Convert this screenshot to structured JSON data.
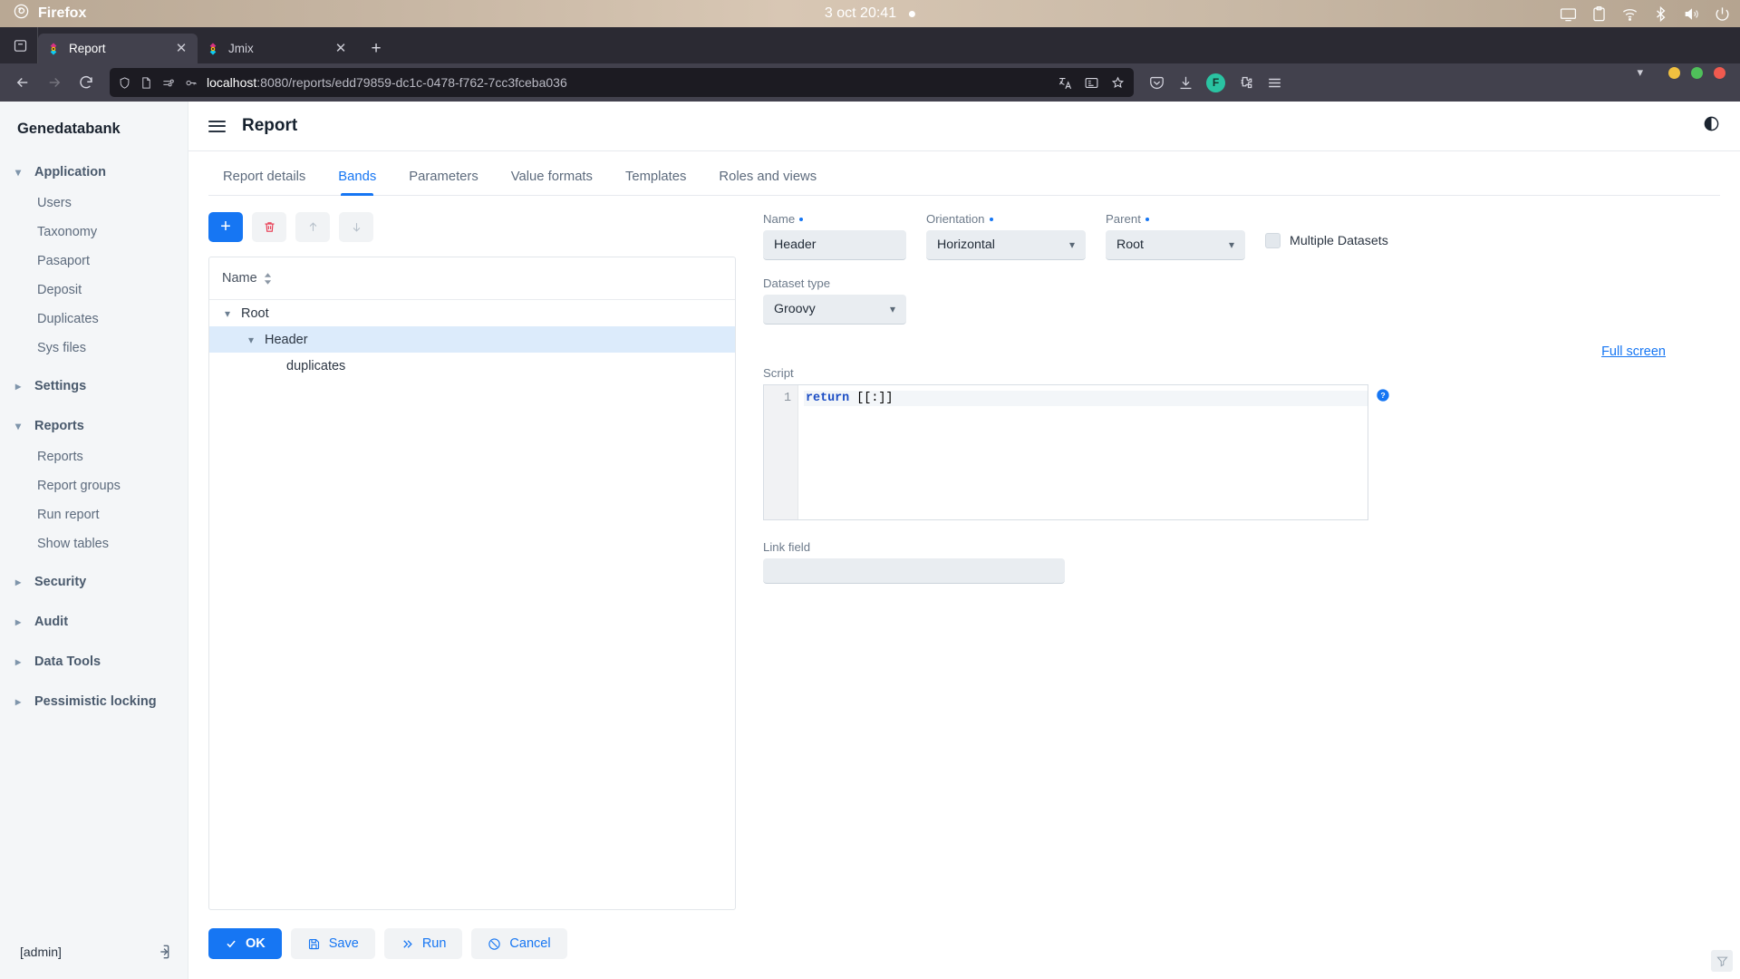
{
  "os": {
    "app_name": "Firefox",
    "clock": "3 oct  20:41",
    "tray_icons": [
      "screen-icon",
      "clipboard-icon",
      "wifi-icon",
      "bluetooth-icon",
      "volume-icon",
      "power-icon"
    ]
  },
  "browser": {
    "tabs": [
      {
        "label": "Report",
        "active": true
      },
      {
        "label": "Jmix",
        "active": false
      }
    ],
    "newtab_label": "+",
    "url_host": "localhost",
    "url_path": ":8080/reports/edd79859-dc1c-0478-f762-7cc3fceba036",
    "profile_initial": "F",
    "nav": {
      "back": "back-arrow",
      "forward": "forward-arrow",
      "reload": "reload-icon"
    }
  },
  "sidebar": {
    "brand": "Genedatabank",
    "groups": [
      {
        "label": "Application",
        "expanded": true,
        "items": [
          "Users",
          "Taxonomy",
          "Pasaport",
          "Deposit",
          "Duplicates",
          "Sys files"
        ]
      },
      {
        "label": "Settings",
        "expanded": false,
        "items": []
      },
      {
        "label": "Reports",
        "expanded": true,
        "items": [
          "Reports",
          "Report groups",
          "Run report",
          "Show tables"
        ]
      },
      {
        "label": "Security",
        "expanded": false,
        "items": []
      },
      {
        "label": "Audit",
        "expanded": false,
        "items": []
      },
      {
        "label": "Data Tools",
        "expanded": false,
        "items": []
      },
      {
        "label": "Pessimistic locking",
        "expanded": false,
        "items": []
      }
    ],
    "user": "[admin]"
  },
  "header": {
    "title": "Report"
  },
  "tabs": [
    {
      "label": "Report details",
      "active": false
    },
    {
      "label": "Bands",
      "active": true
    },
    {
      "label": "Parameters",
      "active": false
    },
    {
      "label": "Value formats",
      "active": false
    },
    {
      "label": "Templates",
      "active": false
    },
    {
      "label": "Roles and views",
      "active": false
    }
  ],
  "tree_toolbar": {
    "add_label": "+",
    "remove_icon": "trash-icon",
    "up_icon": "arrow-up-icon",
    "down_icon": "arrow-down-icon"
  },
  "tree": {
    "column_header": "Name",
    "rows": [
      {
        "label": "Root",
        "level": 1,
        "expanded": true,
        "selected": false,
        "has_toggle": true
      },
      {
        "label": "Header",
        "level": 2,
        "expanded": true,
        "selected": true,
        "has_toggle": true
      },
      {
        "label": "duplicates",
        "level": 3,
        "expanded": false,
        "selected": false,
        "has_toggle": false
      }
    ]
  },
  "form": {
    "name_label": "Name",
    "name_value": "Header",
    "orientation_label": "Orientation",
    "orientation_value": "Horizontal",
    "parent_label": "Parent",
    "parent_value": "Root",
    "multiple_datasets_label": "Multiple Datasets",
    "multiple_datasets_checked": false,
    "dataset_type_label": "Dataset type",
    "dataset_type_value": "Groovy",
    "fullscreen_label": "Full screen",
    "script_label": "Script",
    "script_line_number": "1",
    "script_keyword": "return",
    "script_rest": " [[:]]",
    "help_icon": "help-circle-icon",
    "link_field_label": "Link field",
    "link_field_value": ""
  },
  "footer": {
    "ok_label": "OK",
    "save_label": "Save",
    "run_label": "Run",
    "cancel_label": "Cancel"
  },
  "colors": {
    "accent": "#1676f3",
    "danger": "#e8384f",
    "selection": "#dcebfb",
    "sidebar_bg": "#f4f6f8"
  }
}
